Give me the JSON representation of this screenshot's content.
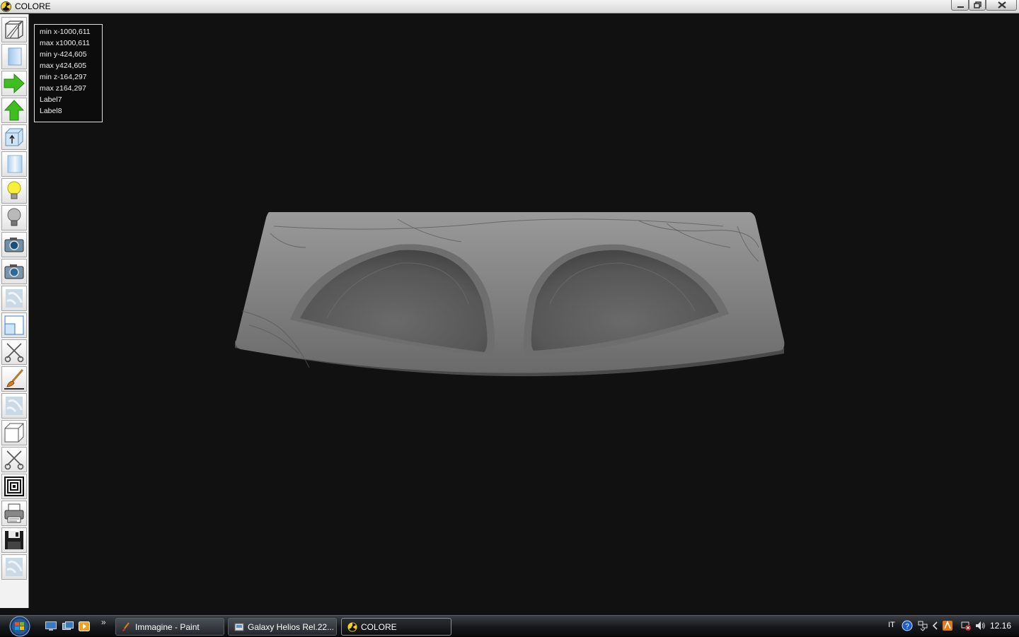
{
  "window": {
    "title": "COLORE"
  },
  "info_box": {
    "lines": [
      "min x-1000,611",
      "max x1000,611",
      "min y-424,605",
      "max y424,605",
      "min z-164,297",
      "max z164,297",
      "Label7",
      "Label8"
    ]
  },
  "toolbar": {
    "tools": [
      "wireframe-box-icon",
      "solid-view-icon",
      "arrow-right-icon",
      "arrow-up-icon",
      "box-up-icon",
      "cylinder-view-icon",
      "light-on-icon",
      "light-off-icon",
      "camera-icon",
      "camera-alt-icon",
      "texture-icon",
      "window-view-icon",
      "scissors-icon",
      "brush-icon",
      "texture-alt-icon",
      "cube-icon",
      "scissors-alt-icon",
      "concentric-squares-icon",
      "printer-icon",
      "floppy-save-icon",
      "texture-extra-icon"
    ]
  },
  "taskbar": {
    "quick_launch_chevron": "»",
    "tasks": [
      {
        "label": "Immagine - Paint",
        "active": false
      },
      {
        "label": "Galaxy Helios  Rel.22...",
        "active": false
      },
      {
        "label": "COLORE",
        "active": true
      }
    ],
    "tray": {
      "language": "IT",
      "clock": "12.16"
    }
  },
  "colors": {
    "viewport_bg": "#111111",
    "marble": "#7c7c7c",
    "accent_green": "#3fbf1f"
  }
}
